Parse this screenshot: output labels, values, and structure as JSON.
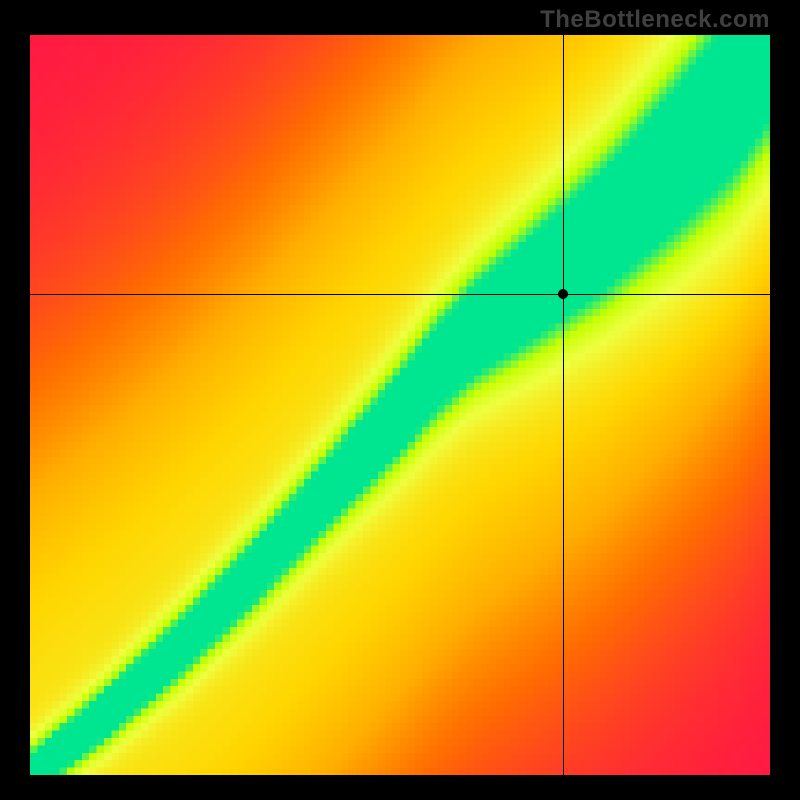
{
  "watermark": "TheBottleneck.com",
  "chart_data": {
    "type": "heatmap",
    "title": "",
    "xlabel": "",
    "ylabel": "",
    "xlim": [
      0,
      100
    ],
    "ylim": [
      0,
      100
    ],
    "grid": false,
    "legend": false,
    "crosshair": {
      "x": 72,
      "y": 65
    },
    "marker": {
      "x": 72,
      "y": 65
    },
    "color_scale": {
      "stops": [
        {
          "v": 0.0,
          "color": "#ff1744"
        },
        {
          "v": 0.25,
          "color": "#ff6d00"
        },
        {
          "v": 0.55,
          "color": "#ffd600"
        },
        {
          "v": 0.75,
          "color": "#eeff41"
        },
        {
          "v": 0.88,
          "color": "#c6ff00"
        },
        {
          "v": 1.0,
          "color": "#00e58f"
        }
      ]
    },
    "ridge": {
      "description": "Optimal diagonal; value falls off with distance from this curve",
      "points": [
        {
          "x": 0,
          "y": 0
        },
        {
          "x": 10,
          "y": 8
        },
        {
          "x": 20,
          "y": 17
        },
        {
          "x": 30,
          "y": 27
        },
        {
          "x": 40,
          "y": 38
        },
        {
          "x": 50,
          "y": 49
        },
        {
          "x": 55,
          "y": 55
        },
        {
          "x": 60,
          "y": 60
        },
        {
          "x": 68,
          "y": 66
        },
        {
          "x": 78,
          "y": 74
        },
        {
          "x": 88,
          "y": 84
        },
        {
          "x": 95,
          "y": 92
        },
        {
          "x": 100,
          "y": 100
        }
      ],
      "width_profile": [
        {
          "x": 0,
          "w": 3
        },
        {
          "x": 20,
          "w": 4
        },
        {
          "x": 40,
          "w": 5
        },
        {
          "x": 60,
          "w": 7
        },
        {
          "x": 80,
          "w": 10
        },
        {
          "x": 100,
          "w": 14
        }
      ]
    },
    "grid_resolution": 100
  }
}
